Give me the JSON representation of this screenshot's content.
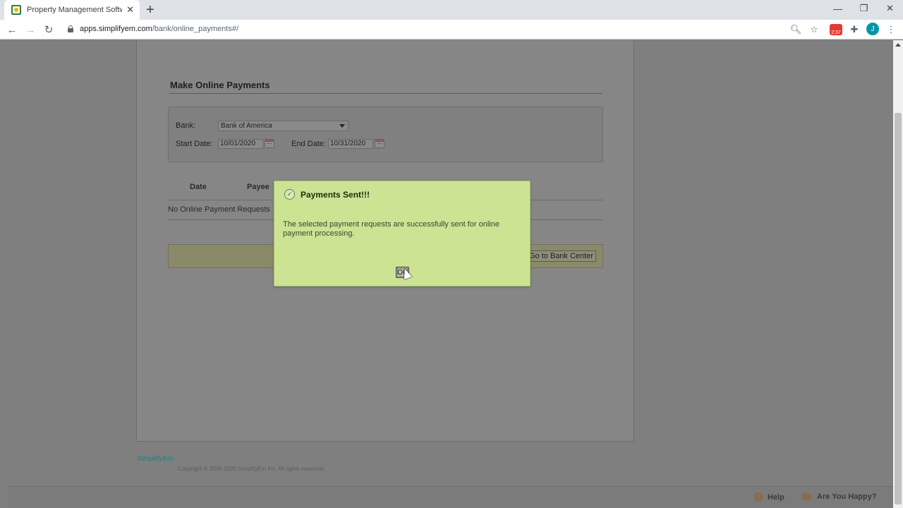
{
  "browser": {
    "tab_title": "Property Management Software",
    "url_host": "apps.simplifyem.com",
    "url_path": "/bank/online_payments#/",
    "extension_badge": "2:37",
    "avatar_letter": "J"
  },
  "page": {
    "heading": "Make Online Payments",
    "filters": {
      "bank_label": "Bank:",
      "bank_value": "Bank of America",
      "start_label": "Start Date:",
      "start_value": "10/01/2020",
      "end_label": "End Date:",
      "end_value": "10/31/2020"
    },
    "table": {
      "headers": [
        "Date",
        "Payee"
      ],
      "empty_message": "No Online Payment Requests"
    },
    "go_bank_center_label": "Go to Bank Center",
    "footer": {
      "logo_text": "SimplifyEm",
      "copyright": "Copyright © 2006-2020 SimplifyEm Inc. All rights reserved."
    },
    "help_bar": {
      "help_label": "Help",
      "happy_label": "Are You Happy?"
    }
  },
  "dialog": {
    "title": "Payments Sent!!!",
    "message": "The selected payment requests are successfully sent for online payment processing.",
    "ok_label": "OK"
  },
  "colors": {
    "dialog_bg": "#cce393",
    "overlay": "#7f7f7f"
  }
}
